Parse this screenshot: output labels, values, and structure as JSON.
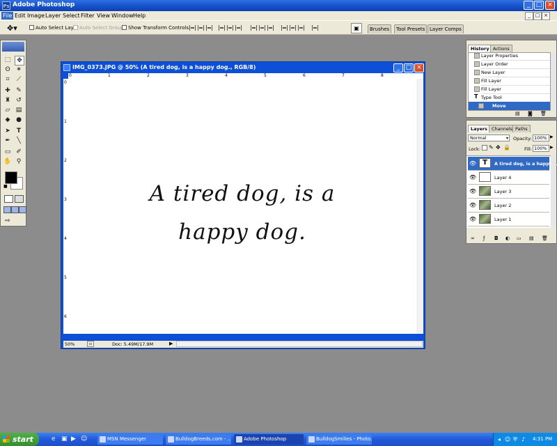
{
  "app": {
    "title": "Adobe Photoshop"
  },
  "menu": [
    "File",
    "Edit",
    "Image",
    "Layer",
    "Select",
    "Filter",
    "View",
    "Window",
    "Help"
  ],
  "options": {
    "auto_select_layer": "Auto Select Layer",
    "auto_select_groups": "Auto Select Groups",
    "show_transform": "Show Transform Controls",
    "tabs": [
      "Brushes",
      "Tool Presets",
      "Layer Comps"
    ]
  },
  "document": {
    "title": "IMG_0373.JPG @ 50% (A tired dog, is a happy dog., RGB/8)",
    "text_line1": "A tired dog, is a",
    "text_line2": "happy dog.",
    "zoom": "50%",
    "doc_size": "Doc: 5.49M/17.9M",
    "ruler_top": [
      "0",
      "1",
      "2",
      "3",
      "4",
      "5",
      "6",
      "7",
      "8"
    ],
    "ruler_left": [
      "0",
      "1",
      "2",
      "3",
      "4",
      "5",
      "6"
    ]
  },
  "history": {
    "tabs": [
      "History",
      "Actions"
    ],
    "items": [
      "Layer Properties",
      "Layer Order",
      "New Layer",
      "Fill Layer",
      "Fill Layer",
      "Type Tool",
      "Move"
    ]
  },
  "layers": {
    "tabs": [
      "Layers",
      "Channels",
      "Paths"
    ],
    "blend_mode": "Normal",
    "opacity_label": "Opacity:",
    "opacity_value": "100%",
    "lock_label": "Lock:",
    "fill_label": "Fill:",
    "fill_value": "100%",
    "type_thumb": "T",
    "items": [
      "A tired dog, is a happy ...",
      "Layer 4",
      "Layer 3",
      "Layer 2",
      "Layer 1"
    ]
  },
  "taskbar": {
    "start": "start",
    "tasks": [
      "MSN Messenger",
      "BulldogBreeds.com - ...",
      "Adobe Photoshop",
      "BulldogSmilies - Photo..."
    ],
    "clock": "4:31 PM"
  }
}
